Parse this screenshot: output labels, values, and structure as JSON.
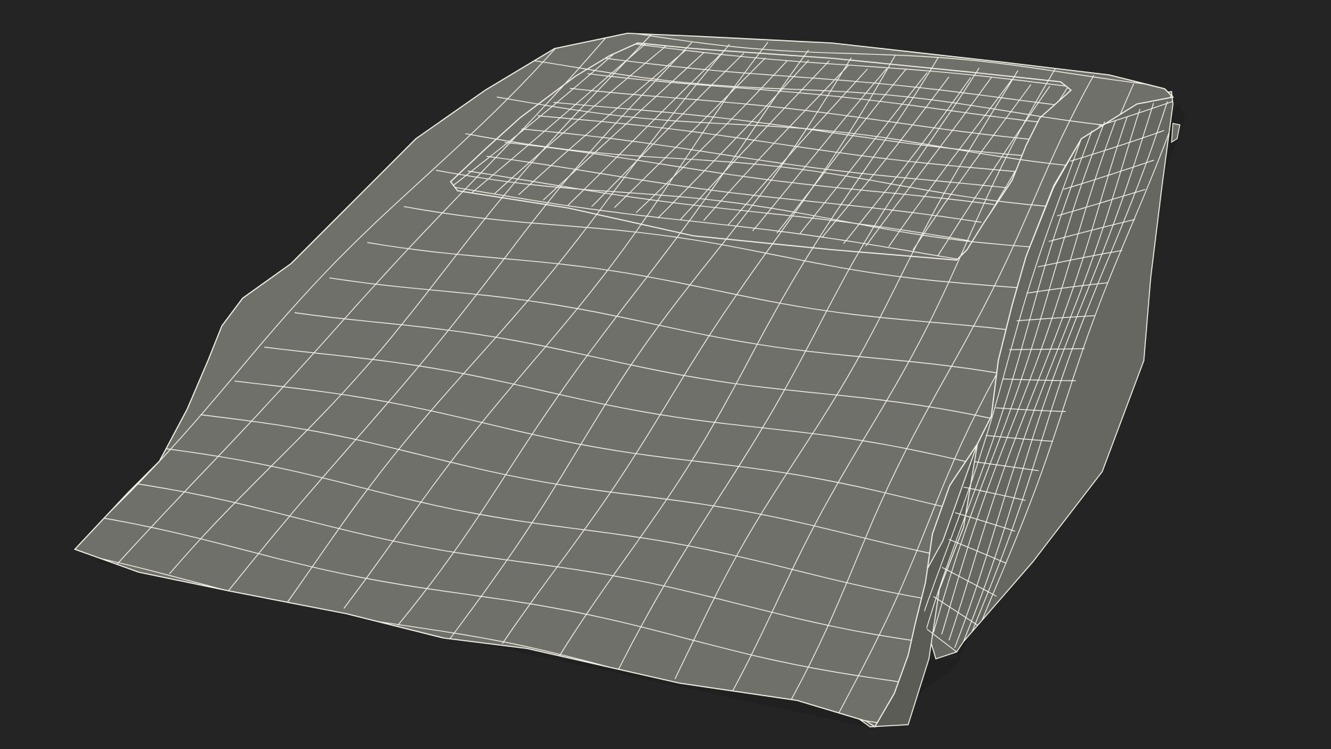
{
  "scene": {
    "subject": "wireframe-bed-model",
    "colors": {
      "background": "#242424",
      "surface": "#70706a",
      "surface_shadow": "#5c5c56",
      "surface_side": "#676761",
      "wire": "#f4f4ea"
    }
  }
}
